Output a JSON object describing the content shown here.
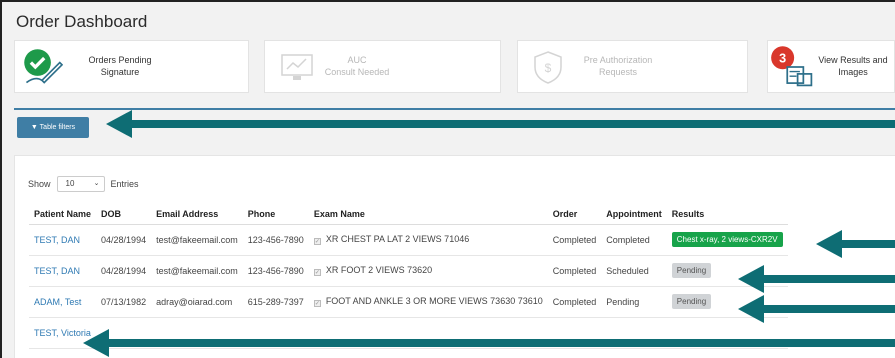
{
  "app": {
    "title": "Order Dashboard"
  },
  "cards": [
    {
      "line1": "Orders Pending",
      "line2": "Signature",
      "icon": "check-pen-icon"
    },
    {
      "line1": "AUC",
      "line2": "Consult Needed",
      "icon": "monitor-chart-icon"
    },
    {
      "line1": "Pre Authorization",
      "line2": "Requests",
      "icon": "shield-dollar-icon"
    },
    {
      "line1": "View Results and",
      "line2": "Images",
      "icon": "results-image-icon",
      "badge": "3"
    }
  ],
  "filters": {
    "label": "Table filters",
    "icon": "filter-icon"
  },
  "show": {
    "prefix": "Show",
    "value": "10",
    "suffix": "Entries"
  },
  "table": {
    "headers": [
      "Patient Name",
      "DOB",
      "Email Address",
      "Phone",
      "Exam Name",
      "Order",
      "Appointment",
      "Results"
    ],
    "rows": [
      {
        "name": "TEST, DAN",
        "dob": "04/28/1994",
        "email": "test@fakeemail.com",
        "phone": "123-456-7890",
        "exam": "XR CHEST PA LAT 2 VIEWS 71046",
        "order": "Completed",
        "appt": "Completed",
        "result": "Chest x-ray, 2 views-CXR2V"
      },
      {
        "name": "TEST, DAN",
        "dob": "04/28/1994",
        "email": "test@fakeemail.com",
        "phone": "123-456-7890",
        "exam": "XR FOOT 2 VIEWS 73620",
        "order": "Completed",
        "appt": "Scheduled",
        "result": "Pending"
      },
      {
        "name": "ADAM, Test",
        "dob": "07/13/1982",
        "email": "adray@oiarad.com",
        "phone": "615-289-7397",
        "exam": "FOOT AND ANKLE 3 OR MORE VIEWS 73630 73610",
        "order": "Completed",
        "appt": "Pending",
        "result": "Pending"
      },
      {
        "name": "TEST, Victoria"
      }
    ]
  },
  "colors": {
    "accent": "#3f7ea5",
    "arrow": "#0e6d74",
    "success": "#17a34a",
    "badge_red": "#d9372b",
    "check_green": "#1e9a4a"
  }
}
